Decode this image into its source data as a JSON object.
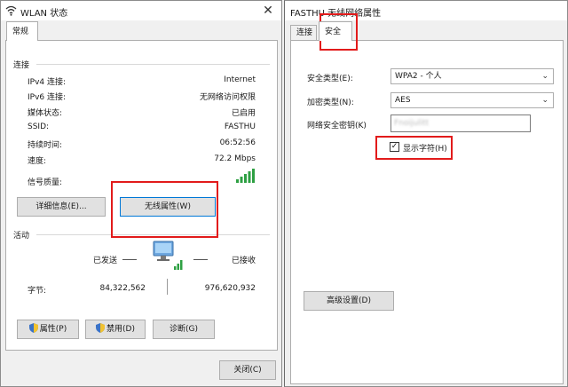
{
  "wlan_status": {
    "title": "WLAN 状态",
    "close_glyph": "✕",
    "tab_general": "常规",
    "connection_group": "连接",
    "rows": [
      {
        "label": "IPv4 连接:",
        "value": "Internet"
      },
      {
        "label": "IPv6 连接:",
        "value": "无网络访问权限"
      },
      {
        "label": "媒体状态:",
        "value": "已启用"
      },
      {
        "label": "SSID:",
        "value": "FASTHU"
      },
      {
        "label": "持续时间:",
        "value": "06:52:56"
      },
      {
        "label": "速度:",
        "value": "72.2 Mbps"
      }
    ],
    "signal_label": "信号质量:",
    "details_button": "详细信息(E)...",
    "wireless_props_button": "无线属性(W)",
    "activity_group": "活动",
    "sent_label": "已发送",
    "received_label": "已接收",
    "bytes_label": "字节:",
    "bytes_sent": "84,322,562",
    "bytes_received": "976,620,932",
    "properties_button": "属性(P)",
    "disable_button": "禁用(D)",
    "diagnose_button": "诊断(G)",
    "close_button": "关闭(C)"
  },
  "wireless_props": {
    "title": "FASTHU 无线网络属性",
    "tab_connection": "连接",
    "tab_security": "安全",
    "security_type_label": "安全类型(E):",
    "security_type_value": "WPA2 - 个人",
    "encryption_type_label": "加密类型(N):",
    "encryption_type_value": "AES",
    "key_label": "网络安全密钥(K)",
    "key_value": "Fnoijulitt",
    "show_chars_label": "显示字符(H)",
    "show_chars_checked": true,
    "advanced_button": "高级设置(D)"
  },
  "colors": {
    "highlight": "#e21b1b",
    "signal": "#2ea043",
    "focus": "#0078d7"
  }
}
